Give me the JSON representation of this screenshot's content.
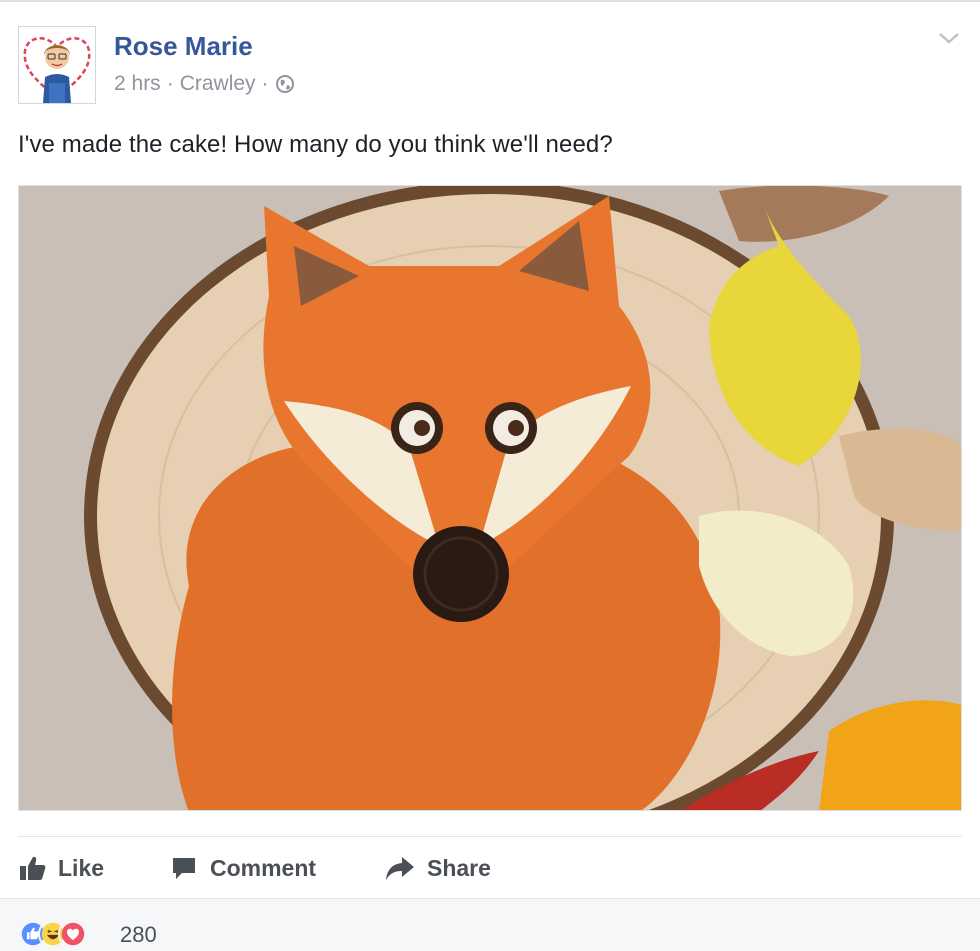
{
  "post": {
    "author": "Rose Marie",
    "time": "2 hrs",
    "location": "Crawley",
    "separator": "·",
    "privacy_icon": "globe-icon",
    "text": "I've made the cake! How many do you think we'll need?",
    "photo_icon": "fox-cake-photo"
  },
  "actions": {
    "like_label": "Like",
    "comment_label": "Comment",
    "share_label": "Share"
  },
  "reactions": {
    "types": [
      "like",
      "haha",
      "love"
    ],
    "count": "280"
  },
  "colors": {
    "link": "#365899",
    "meta": "#90949c",
    "action": "#4b4f56",
    "like_blue": "#5890ff",
    "haha_yellow": "#f7d44a",
    "love_red": "#f25268"
  }
}
